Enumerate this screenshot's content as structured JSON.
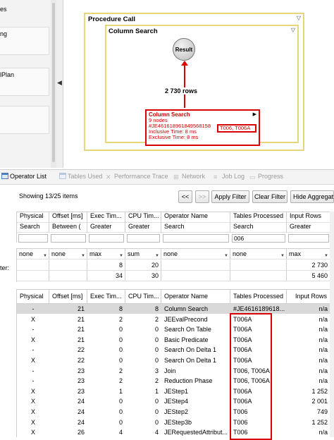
{
  "left_panel": {
    "items": [
      "es",
      "ng",
      "",
      "lPlan",
      ""
    ]
  },
  "diagram": {
    "procedure_title": "Procedure Call",
    "column_search_title": "Column Search",
    "result_label": "Result",
    "edge_rows": "2 730 rows",
    "operator": {
      "title": "Column Search",
      "nodes": "9 nodes",
      "id": "#JE461618961849568158",
      "id_tables": "T006, T006A",
      "inclusive": "Inclusive Time: 8 ms",
      "exclusive": "Exclusive Time: 8 ms"
    }
  },
  "tabs": [
    {
      "label": "Operator List",
      "icon": "table-icon",
      "active": true
    },
    {
      "label": "Tables Used",
      "icon": "table-icon",
      "active": false
    },
    {
      "label": "Performance Trace",
      "icon": "wrench-icon",
      "active": false
    },
    {
      "label": "Network",
      "icon": "network-icon",
      "active": false
    },
    {
      "label": "Job Log",
      "icon": "job-log-icon",
      "active": false
    },
    {
      "label": "Progress",
      "icon": "progress-icon",
      "active": false
    }
  ],
  "toolbar": {
    "showing": "Showing 13/25 items",
    "prev": "<<",
    "next": ">>",
    "apply": "Apply Filter",
    "clear": "Clear Filter",
    "hide": "Hide Aggregati"
  },
  "filter": {
    "headers": [
      "Physical",
      "Offset [ms]",
      "Exec Tim...",
      "CPU Tim...",
      "Operator Name",
      "Tables Processed",
      "Input Rows"
    ],
    "modes": [
      "Search",
      "Between (",
      "Greater",
      "Greater",
      "Search",
      "Search",
      "Greater"
    ],
    "values": [
      "",
      "",
      "",
      "",
      "",
      "006",
      ""
    ]
  },
  "aggregation": {
    "label": "ter:",
    "functions": [
      "none",
      "none",
      "max",
      "sum",
      "none",
      "none",
      "max"
    ],
    "row1": [
      "",
      "",
      "8",
      "20",
      "",
      "",
      "2 730"
    ],
    "row2": [
      "",
      "",
      "34",
      "30",
      "",
      "",
      "5 460"
    ]
  },
  "table": {
    "headers": [
      "Physical",
      "Offset [ms]",
      "Exec Tim...",
      "CPU Tim...",
      "Operator Name",
      "Tables Processed",
      "Input Rows"
    ],
    "rows": [
      [
        "-",
        "21",
        "8",
        "8",
        "Column Search",
        "#JE4616189618...",
        "n/a"
      ],
      [
        "X",
        "21",
        "2",
        "2",
        "JEEvalPrecond",
        "T006A",
        "n/a"
      ],
      [
        "-",
        "21",
        "0",
        "0",
        "Search On Table",
        "T006A",
        "n/a"
      ],
      [
        "X",
        "21",
        "0",
        "0",
        "Basic Predicate",
        "T006A",
        "n/a"
      ],
      [
        "-",
        "22",
        "0",
        "0",
        "Search On Delta 1",
        "T006A",
        "n/a"
      ],
      [
        "X",
        "22",
        "0",
        "0",
        "Search On Delta 1",
        "T006A",
        "n/a"
      ],
      [
        "-",
        "23",
        "2",
        "3",
        "Join",
        "T006, T006A",
        "n/a"
      ],
      [
        "-",
        "23",
        "2",
        "2",
        "Reduction Phase",
        "T006, T006A",
        "n/a"
      ],
      [
        "X",
        "23",
        "1",
        "1",
        "JEStep1",
        "T006A",
        "1 252"
      ],
      [
        "X",
        "24",
        "0",
        "0",
        "JEStep4",
        "T006A",
        "2 001"
      ],
      [
        "X",
        "24",
        "0",
        "0",
        "JEStep2",
        "T006",
        "749"
      ],
      [
        "X",
        "24",
        "0",
        "0",
        "JEStep3b",
        "T006",
        "1 252"
      ],
      [
        "X",
        "26",
        "4",
        "4",
        "JERequestedAttribut...",
        "T006",
        "n/a"
      ]
    ]
  },
  "colors": {
    "highlight": "#d90000",
    "frame": "#e8d77a",
    "selected_row": "#d9d9d9"
  }
}
